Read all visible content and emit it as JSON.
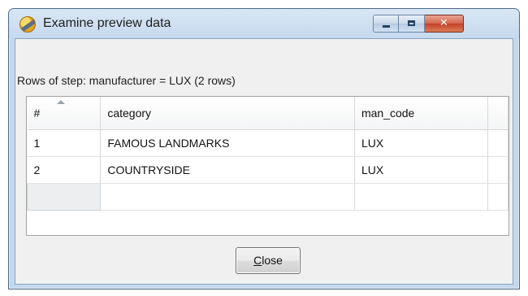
{
  "window": {
    "title": "Examine preview data",
    "controls": {
      "minimize": "minimize",
      "maximize": "maximize",
      "close": "✕"
    }
  },
  "rows_label": "Rows of step: manufacturer = LUX (2 rows)",
  "grid": {
    "columns": [
      "#",
      "category",
      "man_code"
    ],
    "rows": [
      [
        "1",
        "FAMOUS LANDMARKS",
        "LUX"
      ],
      [
        "2",
        "COUNTRYSIDE",
        "LUX"
      ]
    ]
  },
  "close_button": {
    "mnemonic": "C",
    "rest": "lose"
  }
}
